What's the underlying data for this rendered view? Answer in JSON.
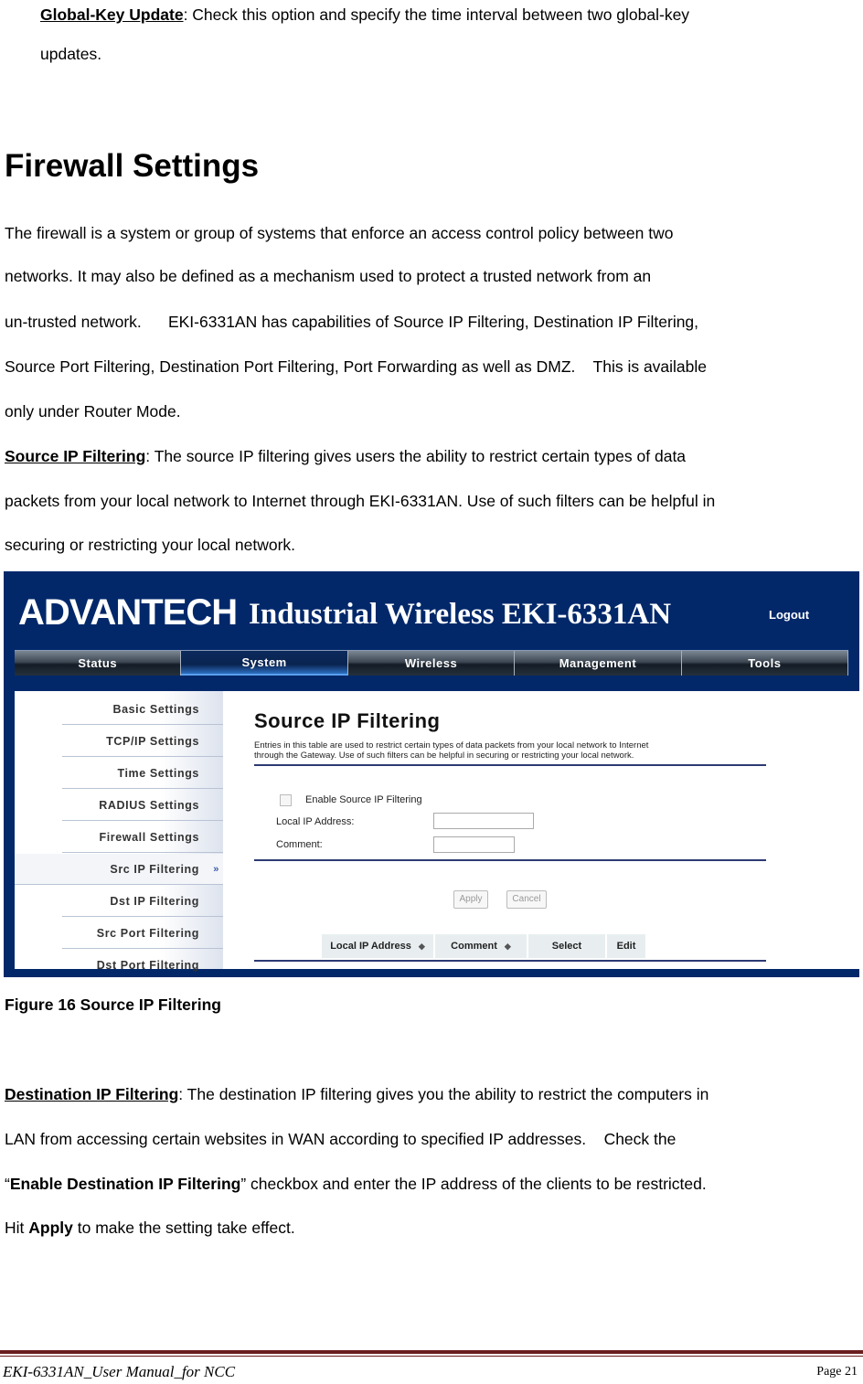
{
  "intro": {
    "term": "Global-Key Update",
    "line1_rest": ": Check this option and specify the time interval between two global-key",
    "line2": "updates."
  },
  "section_title": "Firewall Settings",
  "firewall_paragraph": [
    "The firewall is a system or group of systems that enforce an access control policy between two",
    "networks.    It may also be defined as a mechanism used to protect a trusted network from an",
    "un-trusted network.      EKI-6331AN has capabilities of Source IP Filtering, Destination IP Filtering,",
    "Source Port Filtering, Destination Port Filtering, Port Forwarding as well as DMZ.    This is available",
    "only under Router Mode."
  ],
  "source_ip": {
    "term": "Source IP Filtering",
    "line1_rest": ": The source IP filtering gives users the ability to restrict certain types of data",
    "line2": "packets from your local network to Internet through EKI-6331AN. Use of such filters can be helpful in",
    "line3": "securing or restricting your local network."
  },
  "figure": {
    "brand": "ADVANTECH",
    "product_title": "Industrial Wireless EKI-6331AN",
    "logout": "Logout",
    "nav_tabs": [
      "Status",
      "System",
      "Wireless",
      "Management",
      "Tools"
    ],
    "active_tab": "System",
    "sidebar_items": [
      "Basic Settings",
      "TCP/IP Settings",
      "Time Settings",
      "RADIUS Settings",
      "Firewall Settings",
      "Src IP Filtering",
      "Dst IP Filtering",
      "Src Port Filtering",
      "Dst Port Filtering"
    ],
    "active_sidebar": "Src IP Filtering",
    "page_heading": "Source IP Filtering",
    "description_line1": "Entries in this table are used to restrict certain types of data packets from your local network to Internet",
    "description_line2": "through the Gateway. Use of such filters can be helpful in securing or restricting your local network.",
    "enable_label": "Enable Source IP Filtering",
    "enable_checked": false,
    "local_ip_label": "Local IP Address:",
    "local_ip_value": "",
    "comment_label": "Comment:",
    "comment_value": "",
    "apply_label": "Apply",
    "cancel_label": "Cancel",
    "table_headers": [
      "Local IP Address",
      "Comment",
      "Select",
      "Edit"
    ]
  },
  "caption": "Figure 16 Source IP Filtering",
  "dest_ip": {
    "term": "Destination IP Filtering",
    "line1_rest": ": The destination IP filtering gives you the ability to restrict the computers in",
    "line2": "LAN from accessing certain websites in WAN according to specified IP addresses.    Check the",
    "line3_open": "“",
    "line3_bold": "Enable Destination IP Filtering",
    "line3_rest": "” checkbox and enter the IP address of the clients to be restricted.",
    "line4_start": "Hit ",
    "line4_bold": "Apply",
    "line4_rest": " to make the setting take effect."
  },
  "footer": {
    "left": "EKI-6331AN_User Manual_for NCC",
    "right": "Page 21"
  }
}
